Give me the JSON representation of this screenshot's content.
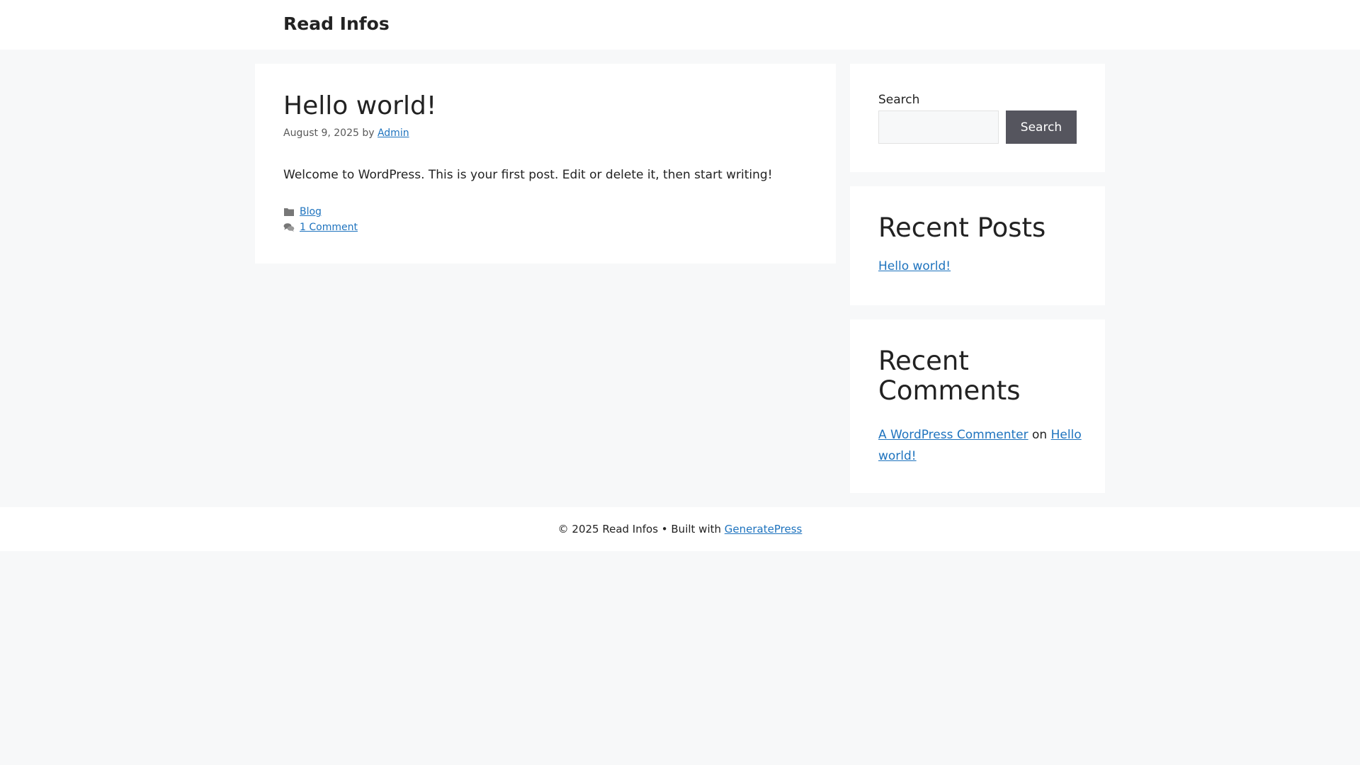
{
  "header": {
    "site_title": "Read Infos"
  },
  "post": {
    "title": "Hello world!",
    "date": "August 9, 2025",
    "by": "by",
    "author": "Admin",
    "content": "Welcome to WordPress. This is your first post. Edit or delete it, then start writing!",
    "category": "Blog",
    "comments_link": "1 Comment",
    "category_icon": "folder-icon",
    "comments_icon": "comments-icon"
  },
  "sidebar": {
    "search": {
      "label": "Search",
      "placeholder": "",
      "value": "",
      "button_label": "Search"
    },
    "recent_posts": {
      "title": "Recent Posts",
      "items": [
        "Hello world!"
      ]
    },
    "recent_comments": {
      "title": "Recent Comments",
      "items": [
        {
          "author": "A WordPress Commenter",
          "on": "on",
          "post": "Hello world!"
        }
      ]
    }
  },
  "footer": {
    "text": "© 2025 Read Infos • Built with",
    "link": "GeneratePress"
  },
  "colors": {
    "link": "#1e73be",
    "button": "#55555e",
    "background": "#f7f8f9"
  }
}
